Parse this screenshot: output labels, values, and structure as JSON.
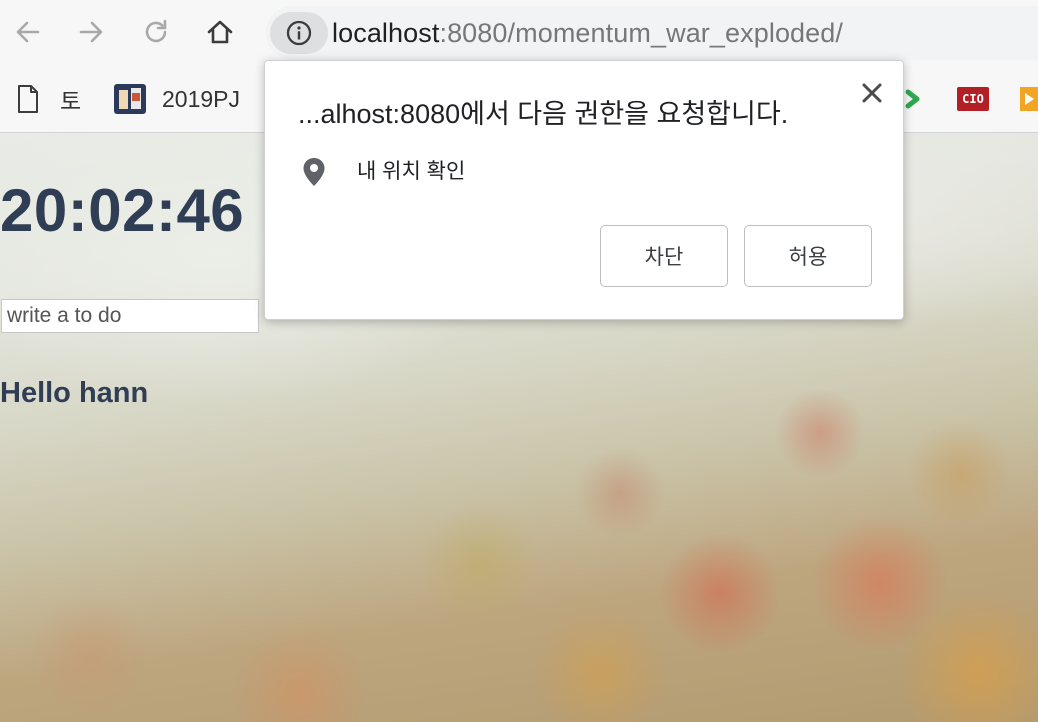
{
  "browser": {
    "url_host": "localhost",
    "url_rest": ":8080/momentum_war_exploded/"
  },
  "bookmarks": {
    "items": [
      {
        "label": "토"
      },
      {
        "label": "2019PJ"
      }
    ],
    "cio_label": "CIO"
  },
  "page": {
    "clock": "20:02:46",
    "todo_placeholder": "write a to do",
    "greeting": "Hello hann"
  },
  "popup": {
    "title": "...alhost:8080에서 다음 권한을 요청합니다.",
    "permission_label": "내 위치 확인",
    "block_label": "차단",
    "allow_label": "허용"
  }
}
